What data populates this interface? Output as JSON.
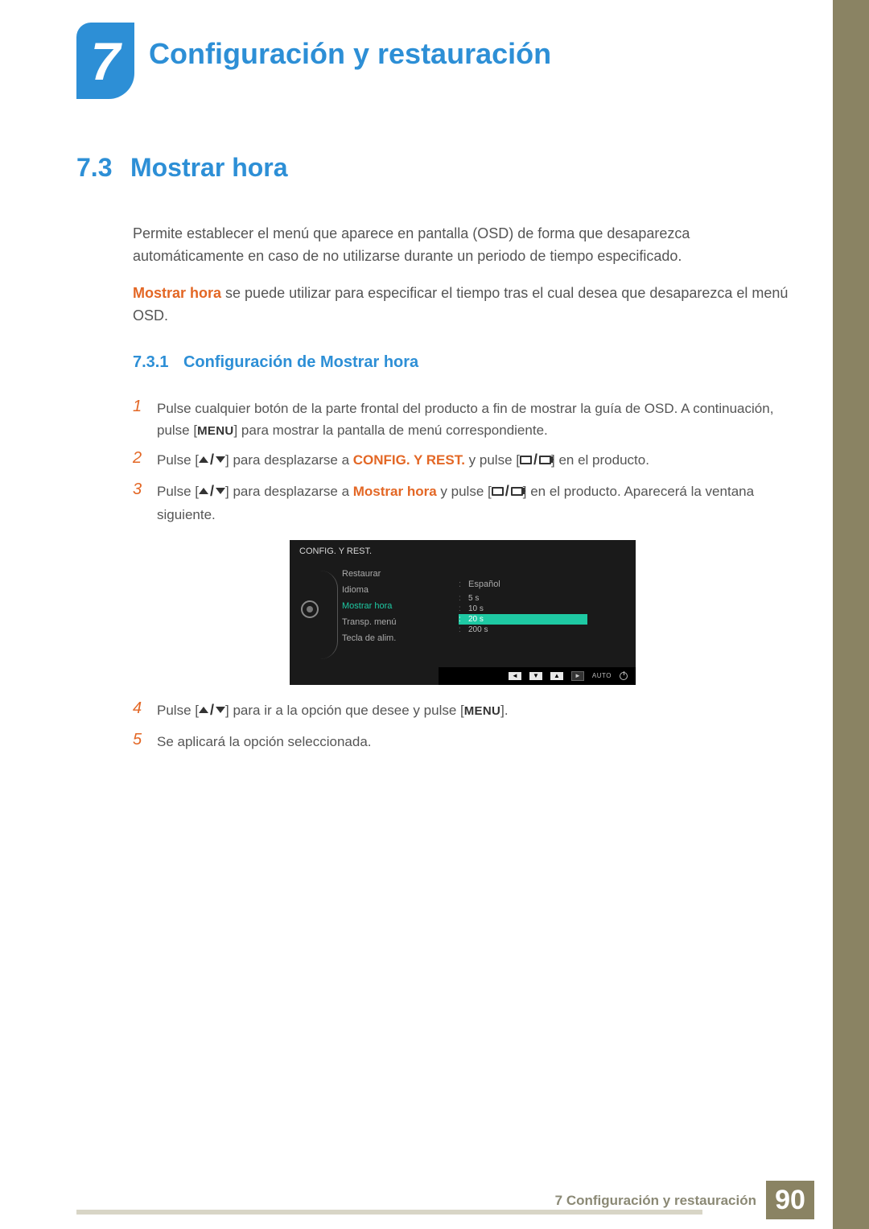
{
  "chapter": {
    "number": "7",
    "title": "Configuración y restauración"
  },
  "section": {
    "number": "7.3",
    "title": "Mostrar hora"
  },
  "intro": {
    "p1": "Permite establecer el menú que aparece en pantalla (OSD) de forma que desaparezca automáticamente en caso de no utilizarse durante un periodo de tiempo especificado.",
    "p2_strong": "Mostrar hora",
    "p2_rest": " se puede utilizar para especificar el tiempo tras el cual desea que desaparezca el menú OSD."
  },
  "subsection": {
    "number": "7.3.1",
    "title": "Configuración de Mostrar hora"
  },
  "steps": {
    "s1a": "Pulse cualquier botón de la parte frontal del producto a fin de mostrar la guía de OSD. A continuación, pulse [",
    "s1_menu": "MENU",
    "s1b": "] para mostrar la pantalla de menú correspondiente.",
    "s2a": "Pulse [",
    "s2b": "] para desplazarse a ",
    "s2_target": "CONFIG. Y REST.",
    "s2c": " y pulse [",
    "s2d": "] en el producto.",
    "s3a": "Pulse [",
    "s3b": "] para desplazarse a ",
    "s3_target": "Mostrar hora",
    "s3c": " y pulse [",
    "s3d": "] en el producto. Aparecerá la ventana siguiente.",
    "s4a": "Pulse [",
    "s4b": "] para ir a la opción que desee y pulse [",
    "s4_menu": "MENU",
    "s4c": "].",
    "s5": "Se aplicará la opción seleccionada."
  },
  "osd": {
    "title": "CONFIG. Y REST.",
    "items": {
      "restore": "Restaurar",
      "language": "Idioma",
      "display_time": "Mostrar hora",
      "transp": "Transp. menú",
      "key": "Tecla de alim."
    },
    "language_value": "Español",
    "options": {
      "o1": "5 s",
      "o2": "10 s",
      "o3": "20 s",
      "o4": "200 s"
    },
    "auto": "AUTO"
  },
  "footer": {
    "text": "7 Configuración y restauración",
    "page": "90"
  }
}
